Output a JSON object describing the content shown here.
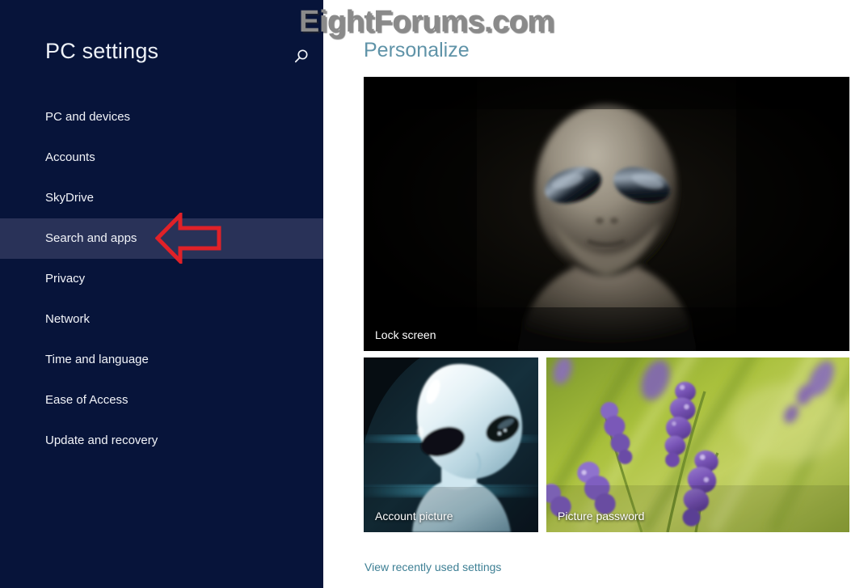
{
  "watermark": {
    "text": "EightForums.com",
    "color": "#8a8a8a"
  },
  "sidebar": {
    "title": "PC settings",
    "search_icon": "search-icon",
    "background_color": "#07143a",
    "selected_color": "#293258",
    "items": [
      {
        "label": "PC and devices",
        "selected": false
      },
      {
        "label": "Accounts",
        "selected": false
      },
      {
        "label": "SkyDrive",
        "selected": false
      },
      {
        "label": "Search and apps",
        "selected": true
      },
      {
        "label": "Privacy",
        "selected": false
      },
      {
        "label": "Network",
        "selected": false
      },
      {
        "label": "Time and language",
        "selected": false
      },
      {
        "label": "Ease of Access",
        "selected": false
      },
      {
        "label": "Update and recovery",
        "selected": false
      }
    ]
  },
  "annotation": {
    "shape": "left-arrow",
    "color": "#e02128",
    "points_to": "Search and apps"
  },
  "main": {
    "title": "Personalize",
    "title_color": "#5f93a8",
    "tiles": [
      {
        "label": "Lock screen",
        "art": "grey-alien-photo",
        "background_color": "#050505"
      },
      {
        "label": "Account picture",
        "art": "white-alien-render",
        "background_color": "#0a1820"
      },
      {
        "label": "Picture password",
        "art": "lavender-flowers-photo",
        "background_color": "#8fa832"
      }
    ],
    "footer_link": {
      "label": "View recently used settings",
      "color": "#3d7f94"
    }
  }
}
